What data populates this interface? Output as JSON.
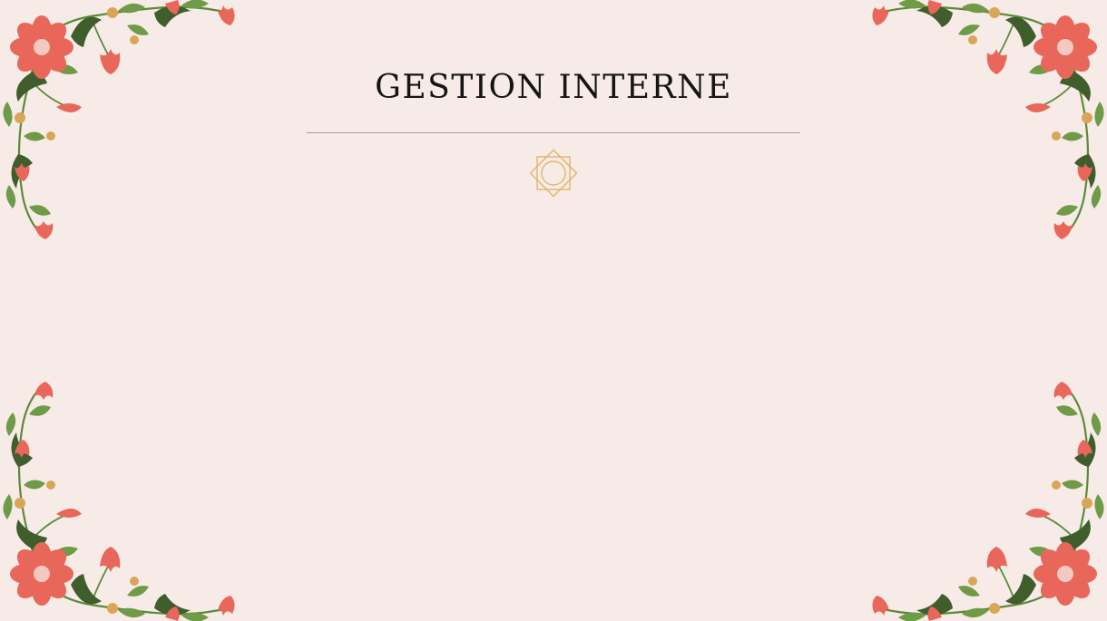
{
  "slide": {
    "title": "GESTION INTERNE"
  },
  "decorations": {
    "corner_motif": "floral-corner-icon",
    "center_motif": "eight-point-star-icon"
  },
  "colors": {
    "background": "#f7ebe7",
    "title": "#151515",
    "divider": "#a59f9c",
    "flower": "#e8675a",
    "flower_center": "#f4c9c2",
    "leaf_dark": "#3f5e2c",
    "leaf_light": "#6f9a47",
    "bud_gold": "#d9a658",
    "ornament": "#e0b56a"
  }
}
